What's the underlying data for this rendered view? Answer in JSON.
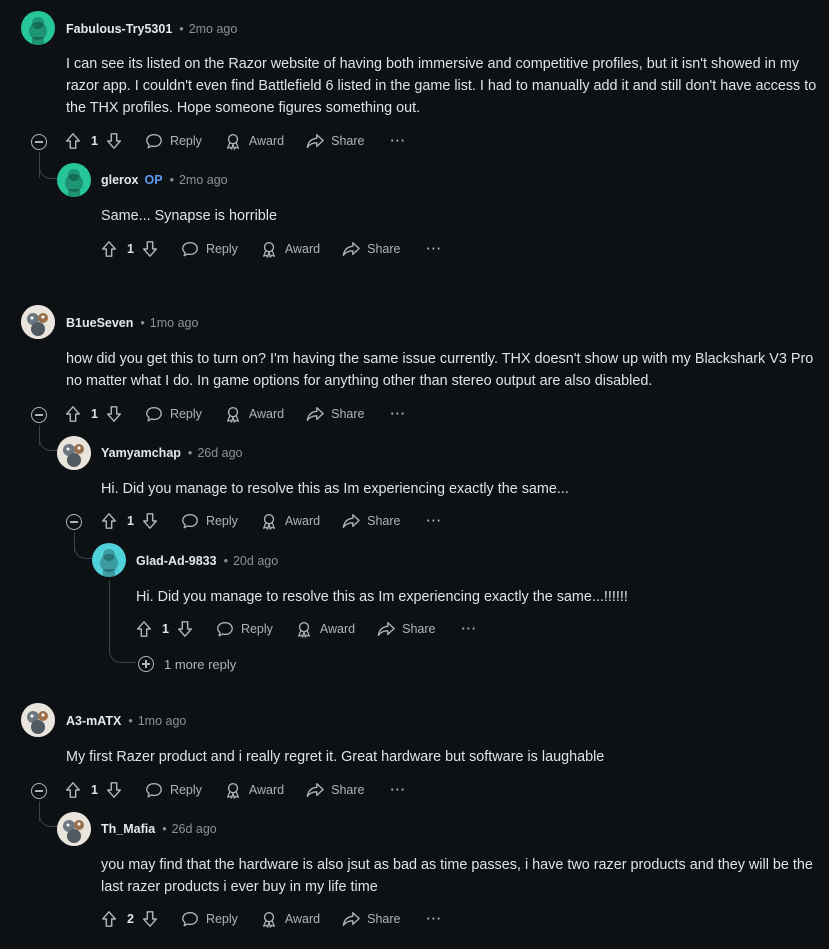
{
  "actions": {
    "reply": "Reply",
    "award": "Award",
    "share": "Share",
    "more": "···"
  },
  "comments": [
    {
      "user": "Fabulous-Try5301",
      "time": "2mo ago",
      "body": "I can see its listed on the Razor website of having both immersive and competitive profiles, but it isn't showed in my razor app. I couldn't even find Battlefield 6 listed in the game list. I had to manually add it and still don't have access to the THX profiles. Hope someone figures something out.",
      "votes": "1"
    },
    {
      "user": "glerox",
      "op": "OP",
      "time": "2mo ago",
      "body": "Same... Synapse is horrible",
      "votes": "1"
    },
    {
      "user": "B1ueSeven",
      "time": "1mo ago",
      "body": "how did you get this to turn on? I'm having the same issue currently. THX doesn't show up with my Blackshark V3 Pro no matter what I do. In game options for anything other than stereo output are also disabled.",
      "votes": "1"
    },
    {
      "user": "Yamyamchap",
      "time": "26d ago",
      "body": "Hi. Did you manage to resolve this as Im experiencing exactly the same...",
      "votes": "1"
    },
    {
      "user": "Glad-Ad-9833",
      "time": "20d ago",
      "body": "Hi. Did you manage to resolve this as Im experiencing exactly the same...!!!!!!",
      "votes": "1"
    },
    {
      "user": "A3-mATX",
      "time": "1mo ago",
      "body": "My first Razer product and i really regret it. Great hardware but software is laughable",
      "votes": "1"
    },
    {
      "user": "Th_Mafia",
      "time": "26d ago",
      "body": "you may find that the hardware is also jsut as bad as time passes, i have two razer products and they will be the last razer products i ever buy in my life time",
      "votes": "2"
    }
  ],
  "more_replies": "1 more reply",
  "dot": "•"
}
